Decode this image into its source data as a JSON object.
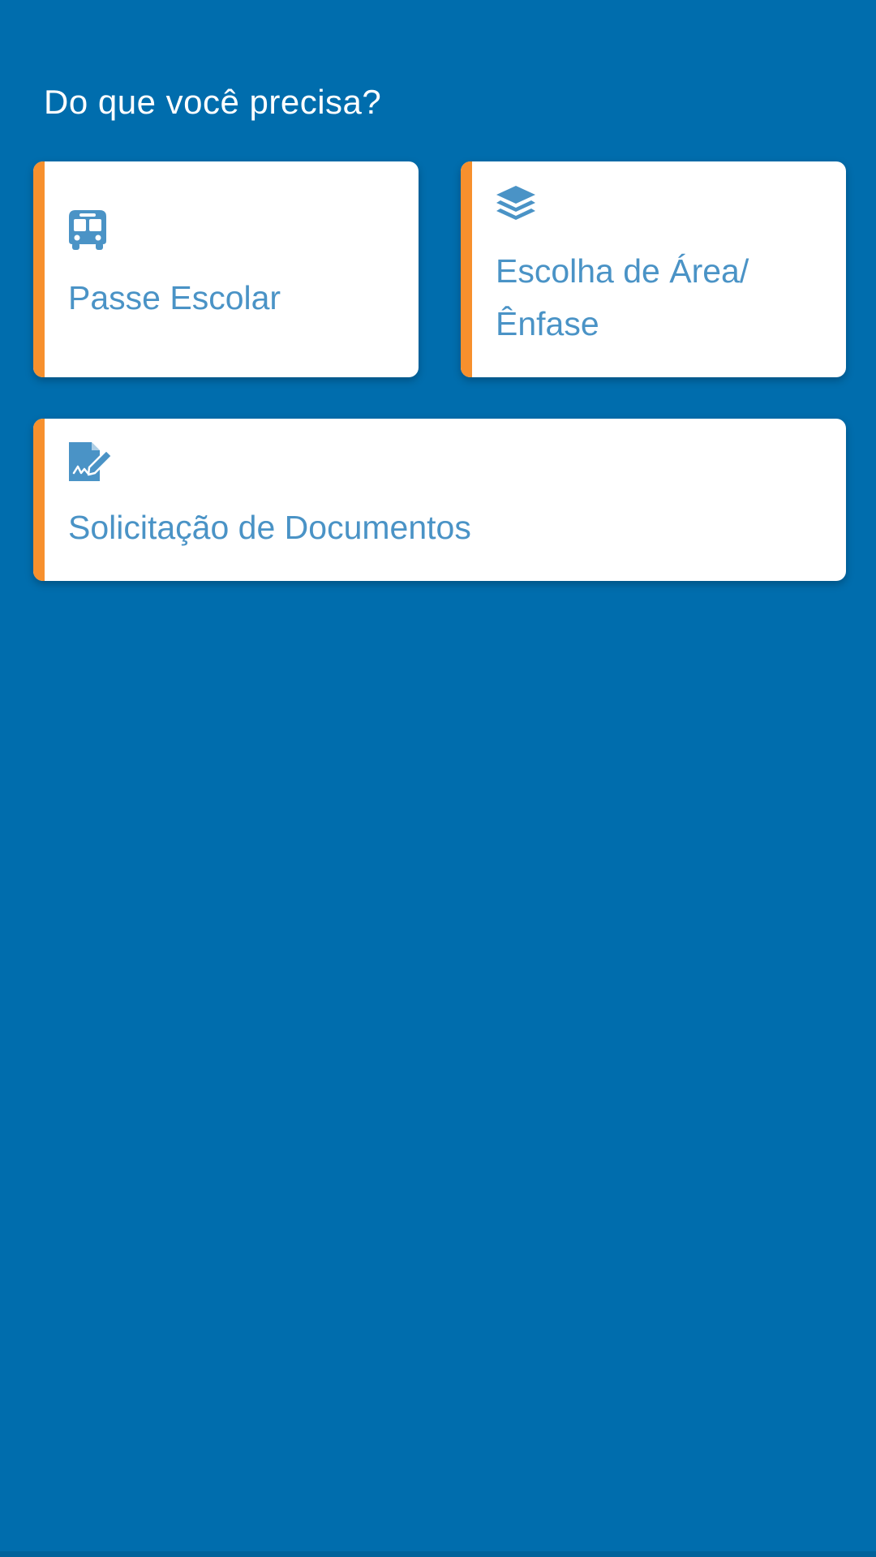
{
  "header": {
    "title": "Do que você precisa?"
  },
  "colors": {
    "background": "#006dad",
    "card_background": "#ffffff",
    "accent_bar": "#f7902d",
    "card_text": "#4a93c6"
  },
  "cards": [
    {
      "label": "Passe Escolar",
      "icon": "bus-icon"
    },
    {
      "label_line1": "Escolha de Área/",
      "label_line2": "Ênfase",
      "icon": "layers-icon"
    },
    {
      "label": "Solicitação de Documentos",
      "icon": "document-signature-icon"
    }
  ]
}
